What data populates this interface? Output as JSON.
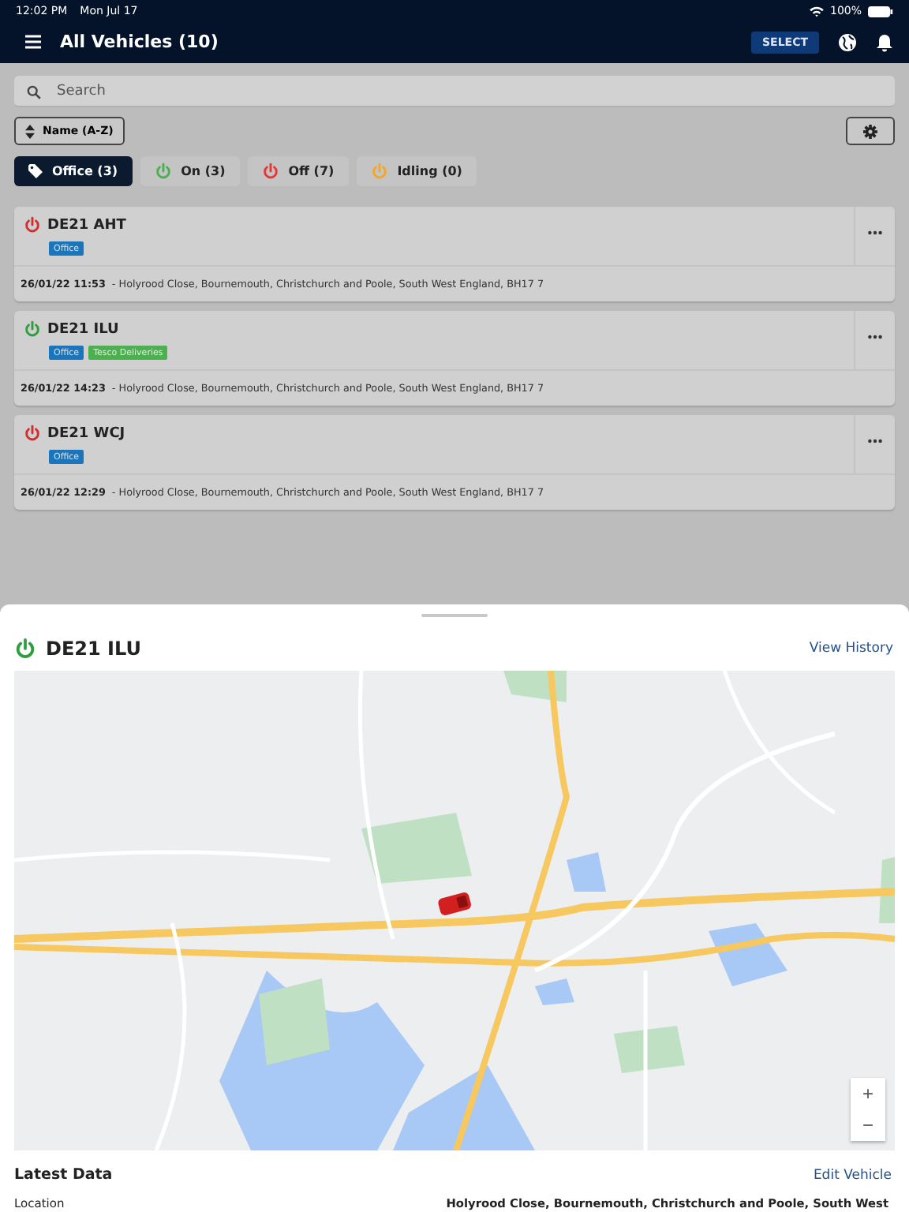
{
  "status_bar": {
    "time": "12:02 PM",
    "date": "Mon Jul 17",
    "battery": "100%"
  },
  "header": {
    "title": "All Vehicles (10)",
    "select_button": "SELECT"
  },
  "search": {
    "placeholder": "Search"
  },
  "sort_button": "Name (A-Z)",
  "filters": [
    {
      "kind": "tag",
      "label": "Office (3)",
      "selected": true
    },
    {
      "kind": "status",
      "label": "On (3)",
      "color": "#4caf50",
      "selected": false
    },
    {
      "kind": "status",
      "label": "Off (7)",
      "color": "#e53935",
      "selected": false
    },
    {
      "kind": "status",
      "label": "Idling (0)",
      "color": "#f5a623",
      "selected": false
    }
  ],
  "vehicles": [
    {
      "name": "DE21 AHT",
      "color": "#d32f2f",
      "tags": [
        {
          "label": "Office",
          "color": "#1b75bb"
        }
      ],
      "timestamp": "26/01/22 11:53",
      "address": "- Holyrood Close, Bournemouth, Christchurch and Poole, South West England, BH17 7"
    },
    {
      "name": "DE21 ILU",
      "color": "#2e9e3e",
      "tags": [
        {
          "label": "Office",
          "color": "#1b75bb"
        },
        {
          "label": "Tesco Deliveries",
          "color": "#4caf50"
        }
      ],
      "timestamp": "26/01/22 14:23",
      "address": "- Holyrood Close, Bournemouth, Christchurch and Poole, South West England, BH17 7"
    },
    {
      "name": "DE21 WCJ",
      "color": "#d32f2f",
      "tags": [
        {
          "label": "Office",
          "color": "#1b75bb"
        }
      ],
      "timestamp": "26/01/22 12:29",
      "address": "- Holyrood Close, Bournemouth, Christchurch and Poole, South West England, BH17 7"
    }
  ],
  "detail": {
    "vehicle": "DE21 ILU",
    "color": "#2e9e3e",
    "history_link": "View History",
    "map": {
      "zoom_in": "+",
      "zoom_out": "−"
    },
    "section_title": "Latest Data",
    "edit_link": "Edit Vehicle",
    "rows": [
      {
        "label": "Location",
        "value": "Holyrood Close, Bournemouth, Christchurch and Poole, South West"
      }
    ]
  }
}
